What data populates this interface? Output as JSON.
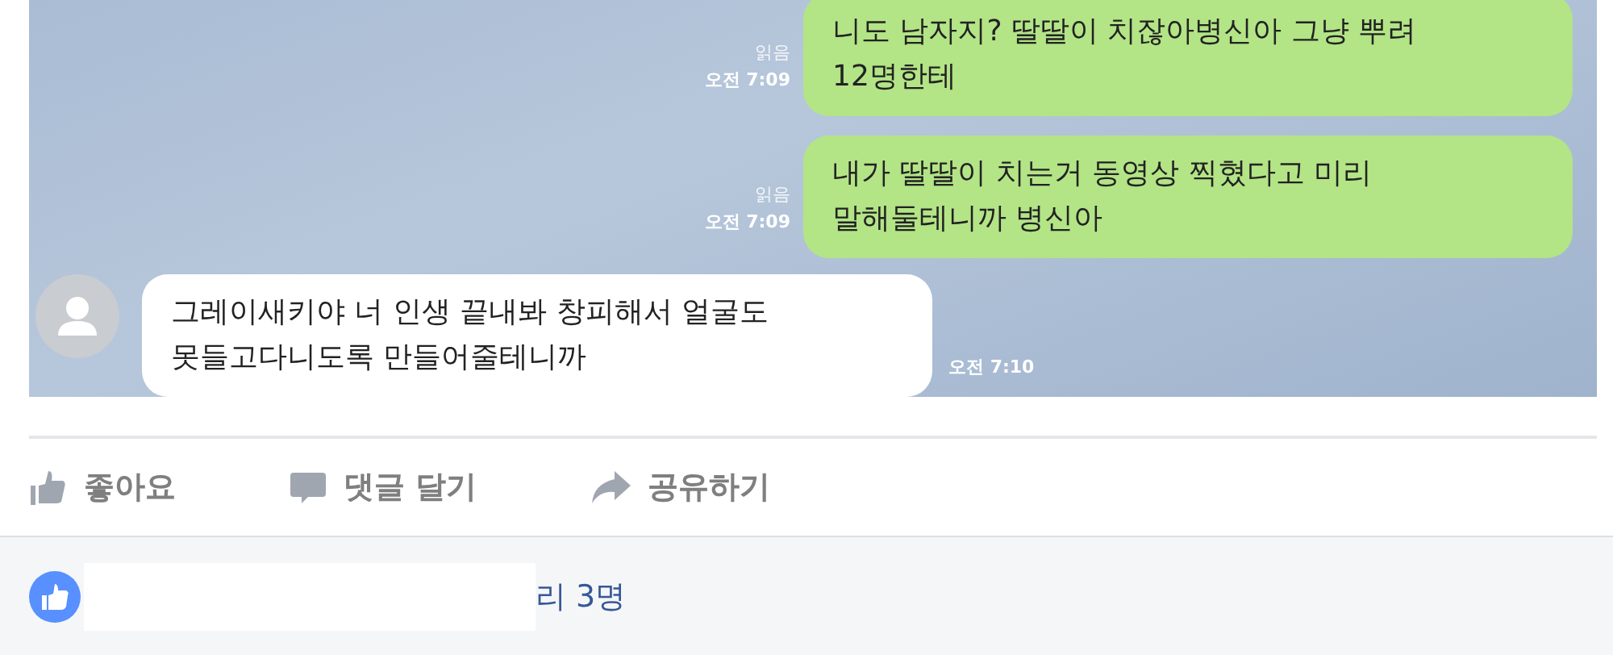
{
  "chat": {
    "messages": [
      {
        "kind": "sent",
        "read": "읽음",
        "time": "오전 7:09",
        "lines": [
          "니도 남자지? 딸딸이 치잖아병신아 그냥 뿌려",
          "12명한테"
        ]
      },
      {
        "kind": "sent",
        "read": "읽음",
        "time": "오전 7:09",
        "lines": [
          "내가 딸딸이 치는거 동영상 찍혔다고 미리",
          "말해둘테니까 병신아"
        ]
      },
      {
        "kind": "received",
        "time": "오전 7:10",
        "lines": [
          "그레이새키야 너 인생 끝내봐 창피해서 얼굴도",
          "못들고다니도록 만들어줄테니까"
        ]
      }
    ]
  },
  "actions": [
    {
      "kind": "like",
      "label": "좋아요"
    },
    {
      "kind": "comment",
      "label": "댓글 달기"
    },
    {
      "kind": "share",
      "label": "공유하기"
    }
  ],
  "likes": {
    "summary": "리 3명"
  }
}
